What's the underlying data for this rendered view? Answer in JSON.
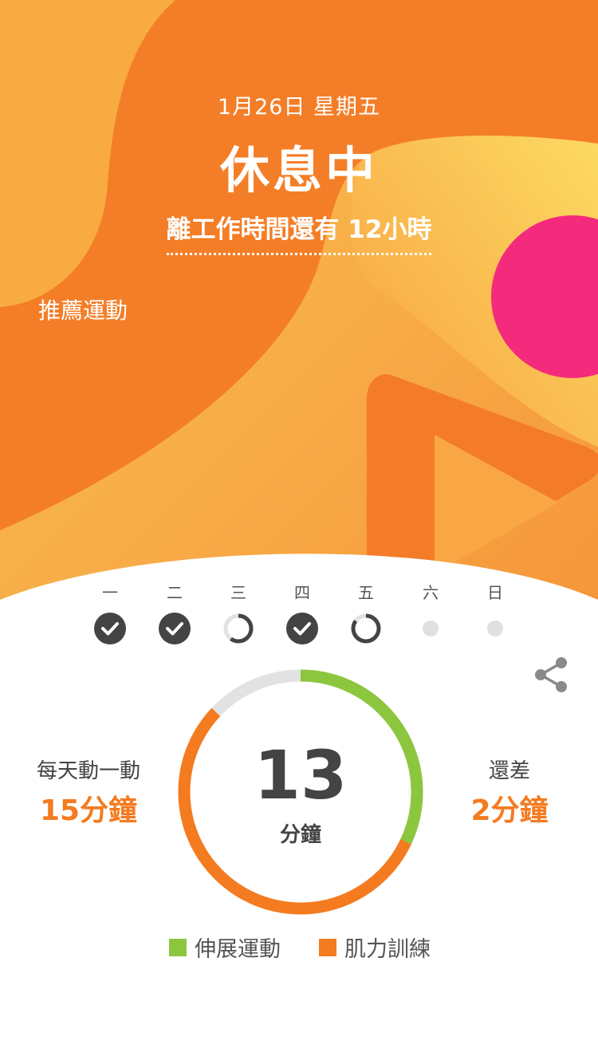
{
  "colors": {
    "orange": "#f47b20",
    "orange_deep": "#f26d21",
    "yellow": "#fbd55c",
    "pink": "#f42a7c",
    "green": "#8cc63f",
    "gray_ring": "#e2e2e2",
    "dark_icon": "#444444",
    "dot_gray": "#e0e0e0"
  },
  "header": {
    "date": "1月26日 星期五",
    "status": "休息中",
    "countdown": "離工作時間還有 12小時",
    "recommend_label": "推薦運動"
  },
  "week": {
    "days": [
      {
        "label": "一",
        "state": "done"
      },
      {
        "label": "二",
        "state": "done"
      },
      {
        "label": "三",
        "state": "partial",
        "progress": 0.6
      },
      {
        "label": "四",
        "state": "done"
      },
      {
        "label": "五",
        "state": "partial",
        "progress": 0.85
      },
      {
        "label": "六",
        "state": "empty"
      },
      {
        "label": "日",
        "state": "empty"
      }
    ]
  },
  "share_icon": "share-icon",
  "progress": {
    "minutes": "13",
    "unit": "分鐘",
    "goal_label": "每天動一動",
    "goal_value": "15分鐘",
    "remaining_label": "還差",
    "remaining_value": "2分鐘",
    "stretch_fraction": 0.32,
    "strength_fraction": 0.55,
    "remaining_fraction": 0.13
  },
  "legend": {
    "stretch": "伸展運動",
    "strength": "肌力訓練"
  }
}
